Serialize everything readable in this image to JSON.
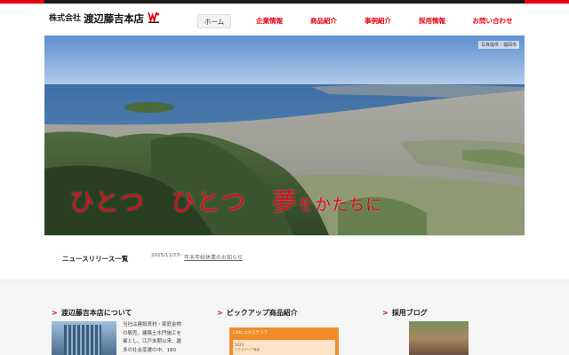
{
  "header": {
    "logo_prefix": "株式会社",
    "logo_name": "渡辺藤吉本店",
    "logo_mark": "W-logo-icon"
  },
  "nav": {
    "items": [
      {
        "label": "ホーム"
      },
      {
        "label": "企業情報"
      },
      {
        "label": "商品紹介"
      },
      {
        "label": "事例紹介"
      },
      {
        "label": "採用情報"
      },
      {
        "label": "お問い合わせ"
      }
    ]
  },
  "hero": {
    "credit": "写真提供｜福岡市",
    "catch_part1": "ひとつ",
    "catch_part2": "ひとつ",
    "catch_part3": "夢",
    "catch_part4": "をかたちに"
  },
  "news": {
    "title": "ニュースリリース一覧",
    "date": "2025/11/27",
    "link": "年末年始休業のお知らせ"
  },
  "sections": {
    "about": {
      "title": "渡辺藤吉本店について",
      "text": "当社は建設資材・家庭金物の販売、建築土木門施工を業とし、江戸末期以来、雑多の社会変遷の中、180"
    },
    "pickup": {
      "title": "ピックアップ商品紹介",
      "tag": "LIXIL エクステリア",
      "sub": "2024",
      "sub2": "エクステリア商品"
    },
    "blog": {
      "title": "採用ブログ"
    }
  },
  "colors": {
    "brand_red": "#e60012",
    "top_bar": "#1a1a1a"
  }
}
